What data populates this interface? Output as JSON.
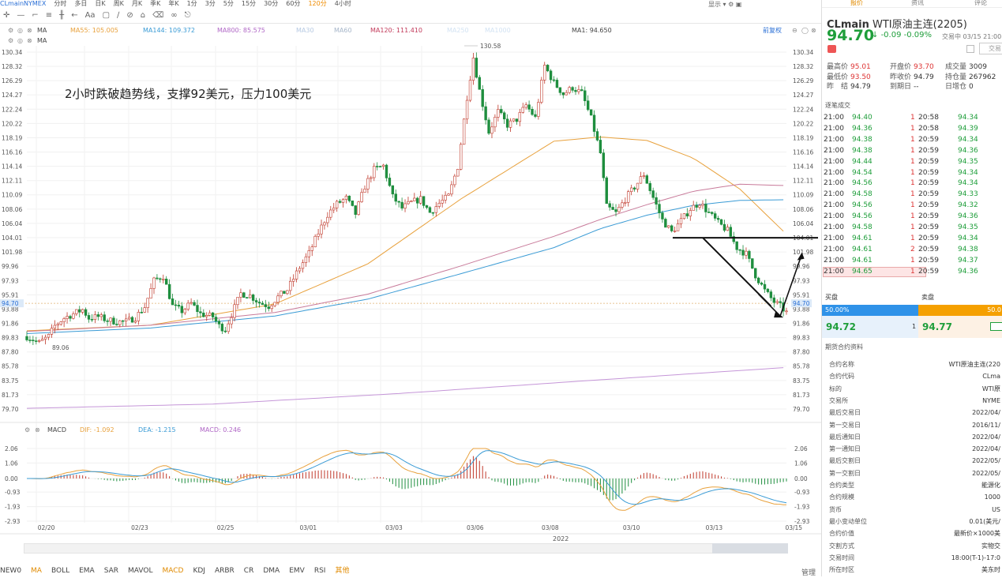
{
  "top": {
    "symbol": "CLmainNYMEX",
    "periods": [
      "分时",
      "多日",
      "日K",
      "周K",
      "月K",
      "季K",
      "年K",
      "1分",
      "3分",
      "5分",
      "15分",
      "30分",
      "60分",
      "120分",
      "4小时"
    ],
    "active": "120分"
  },
  "toolbar": {
    "right": [
      "显示",
      "设置",
      "截图",
      "全屏"
    ]
  },
  "ma": {
    "label": "MA",
    "ma55": "MA55: 105.005",
    "ma144": "MA144: 109.372",
    "ma800": "MA800: 85.575",
    "ma30": "MA30",
    "ma60": "MA60",
    "ma120": "MA120: 111.410",
    "ma250": "MA250",
    "ma1000": "MA1000",
    "ma1": "MA1: 94.650",
    "restore": "前复权"
  },
  "ma_row2": "MA",
  "annotation": "2小时跌破趋势线，支撑92美元，压力100美元",
  "chart_labels": {
    "high": "130.58",
    "low": "89.06"
  },
  "macd": {
    "label": "MACD",
    "dif": "DIF: -1.092",
    "dea": "DEA: -1.215",
    "macd": "MACD: 0.246"
  },
  "y_axis": {
    "left": [
      "130.34",
      "128.32",
      "126.29",
      "124.27",
      "122.24",
      "120.22",
      "118.19",
      "116.16",
      "114.14",
      "112.11",
      "110.09",
      "108.06",
      "106.04",
      "104.01",
      "101.98",
      "99.96",
      "97.93",
      "95.91",
      "94.70",
      "93.88",
      "91.86",
      "89.83",
      "87.80",
      "85.78",
      "83.75",
      "81.73",
      "79.70"
    ],
    "macd_left": [
      "2.06",
      "1.06",
      "0.00",
      "-0.93",
      "-1.93",
      "-2.93"
    ],
    "right": [
      "130.34",
      "128.32",
      "126.29",
      "124.27",
      "122.24",
      "120.22",
      "118.19",
      "116.16",
      "114.14",
      "112.11",
      "110.09",
      "108.06",
      "106.04",
      "104.01",
      "101.98",
      "99.96",
      "97.93",
      "95.91",
      "94.70",
      "93.88",
      "91.86",
      "89.83",
      "87.80",
      "85.78",
      "83.75",
      "81.73",
      "79.70"
    ],
    "macd_right": [
      "2.06",
      "1.06",
      "0.00",
      "-0.93",
      "-1.93",
      "-2.93"
    ]
  },
  "x_axis": [
    "02/20",
    "02/23",
    "02/25",
    "03/01",
    "03/03",
    "03/06",
    "03/08",
    "03/10",
    "03/13",
    "03/15"
  ],
  "year": "2022",
  "bottom": {
    "items": [
      "NEW0",
      "MA",
      "BOLL",
      "EMA",
      "SAR",
      "MAVOL",
      "MACD",
      "KDJ",
      "ARBR",
      "CR",
      "DMA",
      "EMV",
      "RSI",
      "其他"
    ],
    "active": [
      "MA",
      "MACD",
      "其他"
    ],
    "manage": "管理"
  },
  "panel": {
    "tabs": [
      "报价",
      "资讯",
      "评论"
    ],
    "code": "CLmain",
    "name": "WTI原油主连(2205)",
    "price": "94.70",
    "arrow": "↓",
    "change": "-0.09",
    "pct": "-0.09%",
    "status": "交易中 03/15 21:00(美",
    "trade_btn": "交易",
    "stats": [
      {
        "k": "最高价",
        "v": "95.01",
        "c": "red"
      },
      {
        "k": "开盘价",
        "v": "93.70",
        "c": "red"
      },
      {
        "k": "成交量",
        "v": "3009",
        "c": ""
      },
      {
        "k": "最低价",
        "v": "93.50",
        "c": "red"
      },
      {
        "k": "昨收价",
        "v": "94.79",
        "c": ""
      },
      {
        "k": "持仓量",
        "v": "267962",
        "c": ""
      },
      {
        "k": "昨　结",
        "v": "94.79",
        "c": ""
      },
      {
        "k": "到期日",
        "v": "--",
        "c": ""
      },
      {
        "k": "日增仓",
        "v": "0",
        "c": ""
      }
    ],
    "ticks_label": "逐笔成交",
    "ticks": [
      [
        "21:00",
        "94.40",
        "1",
        "20:58",
        "94.34"
      ],
      [
        "21:00",
        "94.36",
        "1",
        "20:58",
        "94.39"
      ],
      [
        "21:00",
        "94.38",
        "1",
        "20:59",
        "94.34"
      ],
      [
        "21:00",
        "94.38",
        "1",
        "20:59",
        "94.36"
      ],
      [
        "21:00",
        "94.44",
        "1",
        "20:59",
        "94.35"
      ],
      [
        "21:00",
        "94.54",
        "1",
        "20:59",
        "94.34"
      ],
      [
        "21:00",
        "94.56",
        "1",
        "20:59",
        "94.34"
      ],
      [
        "21:00",
        "94.58",
        "1",
        "20:59",
        "94.33"
      ],
      [
        "21:00",
        "94.56",
        "1",
        "20:59",
        "94.32"
      ],
      [
        "21:00",
        "94.56",
        "1",
        "20:59",
        "94.36"
      ],
      [
        "21:00",
        "94.58",
        "1",
        "20:59",
        "94.35"
      ],
      [
        "21:00",
        "94.61",
        "1",
        "20:59",
        "94.34"
      ],
      [
        "21:00",
        "94.61",
        "2",
        "20:59",
        "94.38"
      ],
      [
        "21:00",
        "94.61",
        "1",
        "20:59",
        "94.37"
      ],
      [
        "21:00",
        "94.65",
        "1",
        "20:59",
        "94.36"
      ]
    ],
    "depth": {
      "buy_label": "买盘",
      "sell_label": "卖盘",
      "buy_pct": "50.00%",
      "sell_pct": "50.0",
      "bid": "94.72",
      "bid_vol": "1",
      "ask": "94.77",
      "ask_vol": "1"
    },
    "info_label": "期货合约资料",
    "info": [
      [
        "合约名称",
        "WTI原油主连(220"
      ],
      [
        "合约代码",
        "CLma"
      ],
      [
        "标的",
        "WTI原"
      ],
      [
        "交易所",
        "NYME"
      ],
      [
        "最后交易日",
        "2022/04/"
      ],
      [
        "第一交易日",
        "2016/11/"
      ],
      [
        "最后通知日",
        "2022/04/"
      ],
      [
        "第一通知日",
        "2022/04/"
      ],
      [
        "最后交割日",
        "2022/05/"
      ],
      [
        "第一交割日",
        "2022/05/"
      ],
      [
        "合约类型",
        "能源化"
      ],
      [
        "合约规模",
        "1000"
      ],
      [
        "货币",
        "US"
      ],
      [
        "最小变动单位",
        "0.01(美元/"
      ],
      [
        "合约价值",
        "最新价×1000美"
      ],
      [
        "交割方式",
        "实物交"
      ],
      [
        "交易时间",
        "18:00(T-1)-17:0"
      ],
      [
        "所在时区",
        "美东时"
      ]
    ]
  },
  "chart_data": {
    "type": "candlestick",
    "timeframe": "120分",
    "x_ticks": [
      "02/20",
      "02/23",
      "02/25",
      "03/01",
      "03/03",
      "03/06",
      "03/08",
      "03/10",
      "03/13",
      "03/15"
    ],
    "ylim": [
      79.7,
      130.34
    ],
    "current_price": 94.7,
    "close_path": [
      [
        0,
        90.0
      ],
      [
        4,
        89.1
      ],
      [
        7,
        90.0
      ],
      [
        9,
        91.5
      ],
      [
        12,
        92.6
      ],
      [
        15,
        93.2
      ],
      [
        18,
        93.8
      ],
      [
        20,
        92.6
      ],
      [
        23,
        92.8
      ],
      [
        26,
        92.3
      ],
      [
        29,
        92.1
      ],
      [
        32,
        92.1
      ],
      [
        35,
        92.7
      ],
      [
        38,
        94.2
      ],
      [
        41,
        97.9
      ],
      [
        44,
        98.6
      ],
      [
        47,
        94.3
      ],
      [
        50,
        93.6
      ],
      [
        53,
        94.7
      ],
      [
        56,
        93.2
      ],
      [
        60,
        92.8
      ],
      [
        62,
        91.5
      ],
      [
        64,
        91.0
      ],
      [
        66,
        93.1
      ],
      [
        69,
        96.1
      ],
      [
        72,
        95.8
      ],
      [
        75,
        94.8
      ],
      [
        78,
        94.3
      ],
      [
        81,
        95.6
      ],
      [
        84,
        96.6
      ],
      [
        88,
        99.8
      ],
      [
        91,
        101.8
      ],
      [
        94,
        104.7
      ],
      [
        97,
        107.3
      ],
      [
        100,
        108.8
      ],
      [
        103,
        109.6
      ],
      [
        106,
        107.4
      ],
      [
        109,
        111.3
      ],
      [
        112,
        113.7
      ],
      [
        115,
        114.2
      ],
      [
        118,
        109.8
      ],
      [
        121,
        108.2
      ],
      [
        124,
        109.0
      ],
      [
        127,
        109.5
      ],
      [
        130,
        107.6
      ],
      [
        133,
        108.9
      ],
      [
        136,
        109.9
      ],
      [
        139,
        114.1
      ],
      [
        142,
        124.0
      ],
      [
        144,
        129.6
      ],
      [
        146,
        124.9
      ],
      [
        149,
        119.0
      ],
      [
        152,
        121.9
      ],
      [
        155,
        120.0
      ],
      [
        158,
        120.8
      ],
      [
        161,
        122.8
      ],
      [
        164,
        121.0
      ],
      [
        167,
        128.4
      ],
      [
        170,
        126.0
      ],
      [
        173,
        124.4
      ],
      [
        176,
        125.3
      ],
      [
        179,
        124.5
      ],
      [
        182,
        120.9
      ],
      [
        185,
        116.0
      ],
      [
        187,
        108.4
      ],
      [
        190,
        107.5
      ],
      [
        193,
        109.5
      ],
      [
        196,
        111.2
      ],
      [
        199,
        113.0
      ],
      [
        202,
        109.7
      ],
      [
        205,
        106.5
      ],
      [
        208,
        104.8
      ],
      [
        211,
        106.4
      ],
      [
        214,
        108.1
      ],
      [
        217,
        109.0
      ],
      [
        220,
        107.5
      ],
      [
        223,
        106.1
      ],
      [
        226,
        105.0
      ],
      [
        229,
        102.6
      ],
      [
        232,
        101.7
      ],
      [
        235,
        98.7
      ],
      [
        238,
        96.5
      ],
      [
        241,
        94.9
      ],
      [
        243,
        94.3
      ],
      [
        245,
        93.4
      ]
    ],
    "ma_series": [
      {
        "name": "MA55",
        "last": 105.005,
        "color": "#e8a13c",
        "points": [
          [
            0,
            90.8
          ],
          [
            40,
            91.6
          ],
          [
            80,
            94.6
          ],
          [
            110,
            100.3
          ],
          [
            140,
            109.5
          ],
          [
            170,
            117.7
          ],
          [
            185,
            118.3
          ],
          [
            200,
            117.8
          ],
          [
            215,
            115.3
          ],
          [
            230,
            110.9
          ],
          [
            245,
            104.5
          ]
        ]
      },
      {
        "name": "MA144",
        "last": 109.372,
        "color": "#3a9bd5",
        "points": [
          [
            0,
            90.4
          ],
          [
            40,
            91.2
          ],
          [
            80,
            92.9
          ],
          [
            110,
            95.3
          ],
          [
            140,
            98.9
          ],
          [
            170,
            102.6
          ],
          [
            185,
            105.3
          ],
          [
            200,
            107.2
          ],
          [
            215,
            108.6
          ],
          [
            230,
            109.3
          ],
          [
            245,
            109.4
          ]
        ]
      },
      {
        "name": "MA120",
        "last": 111.41,
        "color": "#c87a9a",
        "points": [
          [
            0,
            90.7
          ],
          [
            40,
            91.6
          ],
          [
            80,
            93.4
          ],
          [
            110,
            96.0
          ],
          [
            140,
            100.0
          ],
          [
            170,
            104.2
          ],
          [
            185,
            106.6
          ],
          [
            200,
            108.7
          ],
          [
            215,
            110.6
          ],
          [
            230,
            111.6
          ],
          [
            245,
            111.4
          ]
        ]
      },
      {
        "name": "MA800",
        "last": 85.575,
        "color": "#c596d8",
        "points": [
          [
            0,
            79.8
          ],
          [
            60,
            80.4
          ],
          [
            120,
            81.9
          ],
          [
            180,
            83.7
          ],
          [
            245,
            85.6
          ]
        ]
      }
    ],
    "annotations": {
      "support_level": 104.0,
      "trend_line": [
        [
          218,
          104.0
        ],
        [
          240,
          94.3
        ]
      ],
      "projection": [
        [
          236,
          96.0
        ],
        [
          243,
          92.9
        ],
        [
          250,
          101.7
        ]
      ]
    },
    "macd": {
      "ylim": [
        -2.93,
        2.06
      ],
      "dif": -1.092,
      "dea": -1.215,
      "macd": 0.246
    }
  }
}
